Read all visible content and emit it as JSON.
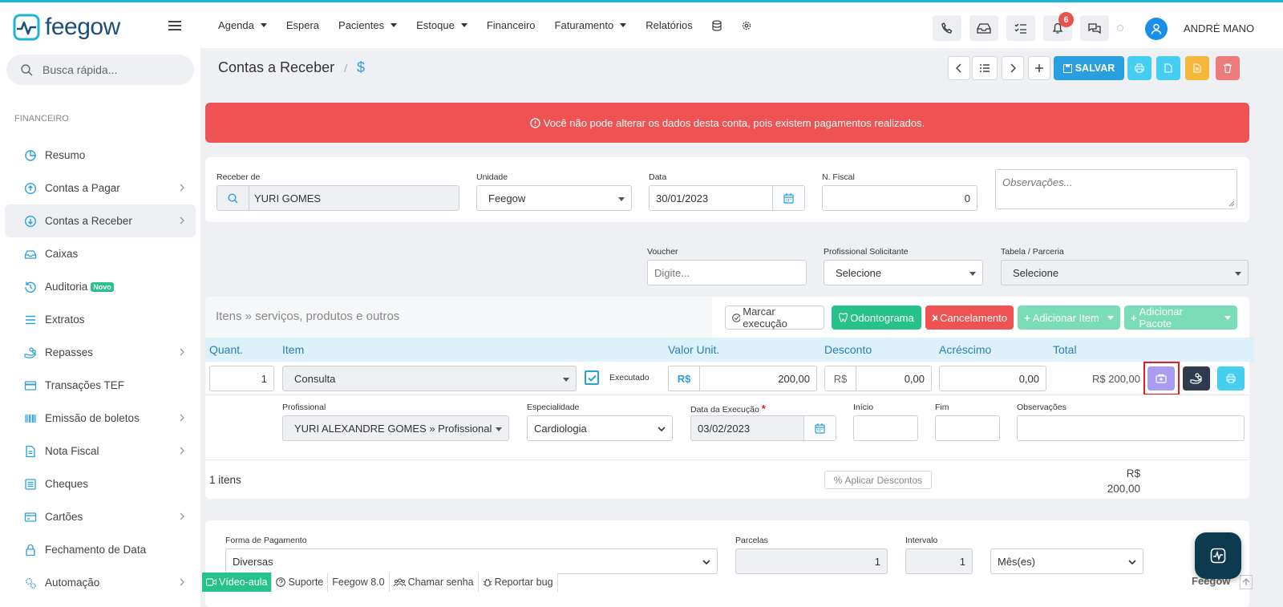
{
  "topbar": {
    "logo": "feegow",
    "nav": [
      {
        "label": "Agenda",
        "caret": true
      },
      {
        "label": "Espera",
        "caret": false
      },
      {
        "label": "Pacientes",
        "caret": true
      },
      {
        "label": "Estoque",
        "caret": true
      },
      {
        "label": "Financeiro",
        "caret": false
      },
      {
        "label": "Faturamento",
        "caret": true
      },
      {
        "label": "Relatórios",
        "caret": false
      }
    ],
    "notification_count": "6",
    "user": "ANDRÉ MANO"
  },
  "sidebar": {
    "search_placeholder": "Busca rápida...",
    "section": "FINANCEIRO",
    "items": [
      {
        "label": "Resumo",
        "icon": "pie-chart-icon",
        "chevron": false
      },
      {
        "label": "Contas a Pagar",
        "icon": "arrow-up-circle-icon",
        "chevron": true
      },
      {
        "label": "Contas a Receber",
        "icon": "arrow-down-circle-icon",
        "chevron": true,
        "active": true
      },
      {
        "label": "Caixas",
        "icon": "inbox-icon",
        "chevron": false
      },
      {
        "label": "Auditoria",
        "icon": "history-icon",
        "chevron": false,
        "badge": "Novo"
      },
      {
        "label": "Extratos",
        "icon": "list-icon",
        "chevron": false
      },
      {
        "label": "Repasses",
        "icon": "hand-coins-icon",
        "chevron": true
      },
      {
        "label": "Transações TEF",
        "icon": "credit-card-icon",
        "chevron": false
      },
      {
        "label": "Emissão de boletos",
        "icon": "barcode-icon",
        "chevron": true
      },
      {
        "label": "Nota Fiscal",
        "icon": "document-icon",
        "chevron": true
      },
      {
        "label": "Cheques",
        "icon": "check-list-icon",
        "chevron": false
      },
      {
        "label": "Cartões",
        "icon": "card-icon",
        "chevron": true
      },
      {
        "label": "Fechamento de Data",
        "icon": "lock-icon",
        "chevron": false
      },
      {
        "label": "Automação",
        "icon": "gears-icon",
        "chevron": true
      }
    ]
  },
  "page": {
    "title": "Contas a Receber",
    "subtitle": "$",
    "save_label": "SALVAR"
  },
  "alert": "Você não pode alterar os dados desta conta, pois existem pagamentos realizados.",
  "form": {
    "receber_de_label": "Receber de",
    "receber_de": "YURI GOMES",
    "unidade_label": "Unidade",
    "unidade": "Feegow",
    "data_label": "Data",
    "data": "30/01/2023",
    "nfiscal_label": "N. Fiscal",
    "nfiscal": "0",
    "obs_placeholder": "Observações...",
    "voucher_label": "Voucher",
    "voucher_placeholder": "Digite...",
    "prof_sol_label": "Profissional Solicitante",
    "prof_sol": "Selecione",
    "tabela_label": "Tabela / Parceria",
    "tabela": "Selecione"
  },
  "items": {
    "title": "Itens » serviços, produtos e outros",
    "marcar": "Marcar execução",
    "odonto": "Odontograma",
    "cancel": "Cancelamento",
    "add_item": "Adicionar Item",
    "add_pacote": "Adicionar Pacote",
    "headers": {
      "quant": "Quant.",
      "item": "Item",
      "valor": "Valor Unit.",
      "desconto": "Desconto",
      "acrescimo": "Acréscimo",
      "total": "Total"
    },
    "row": {
      "quant": "1",
      "item": "Consulta",
      "executado": "Executado",
      "cur": "R$",
      "valor": "200,00",
      "desconto": "0,00",
      "acrescimo": "0,00",
      "total": "R$ 200,00"
    },
    "detail": {
      "prof_label": "Profissional",
      "prof": "YURI ALEXANDRE GOMES » Profissional",
      "esp_label": "Especialidade",
      "esp": "Cardiologia",
      "dexec_label": "Data da Execução",
      "req": "*",
      "dexec": "03/02/2023",
      "inicio_label": "Início",
      "fim_label": "Fim",
      "obs_label": "Observações"
    },
    "count": "1 itens",
    "aplicar": "Aplicar Descontos",
    "sum_cur": "R$",
    "sum_value": "200,00"
  },
  "payment": {
    "forma_label": "Forma de Pagamento",
    "forma": "Diversas",
    "parcelas_label": "Parcelas",
    "parcelas": "1",
    "intervalo_label": "Intervalo",
    "intervalo": "1",
    "periodo": "Mês(es)"
  },
  "footer": {
    "video": "Vídeo-aula",
    "suporte": "Suporte",
    "version": "Feegow 8.0",
    "chamar": "Chamar senha",
    "bug": "Reportar bug",
    "brand": "Feegow"
  },
  "colors": {
    "primary": "#2a9fe0",
    "danger": "#ee5253",
    "success": "#27c28b",
    "warning": "#f4b73b"
  }
}
